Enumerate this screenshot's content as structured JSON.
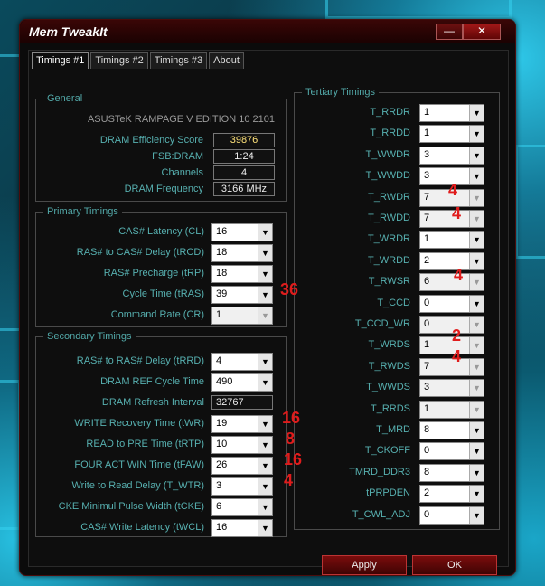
{
  "window": {
    "title": "Mem TweakIt",
    "minimize_label": "—",
    "close_label": "✕"
  },
  "tabs": [
    "Timings #1",
    "Timings #2",
    "Timings #3",
    "About"
  ],
  "general": {
    "title": "General",
    "board": "ASUSTeK RAMPAGE V EDITION 10 2101",
    "efficiency_label": "DRAM Efficiency Score",
    "efficiency_value": "39876",
    "fsb_label": "FSB:DRAM",
    "fsb_value": "1:24",
    "channels_label": "Channels",
    "channels_value": "4",
    "freq_label": "DRAM Frequency",
    "freq_value": "3166 MHz"
  },
  "primary": {
    "title": "Primary Timings",
    "rows": [
      {
        "label": "CAS# Latency (CL)",
        "value": "16",
        "disabled": false
      },
      {
        "label": "RAS# to CAS# Delay (tRCD)",
        "value": "18",
        "disabled": false
      },
      {
        "label": "RAS# Precharge (tRP)",
        "value": "18",
        "disabled": false
      },
      {
        "label": "Cycle Time (tRAS)",
        "value": "39",
        "disabled": false
      },
      {
        "label": "Command Rate (CR)",
        "value": "1",
        "disabled": true
      }
    ]
  },
  "secondary": {
    "title": "Secondary Timings",
    "rows": [
      {
        "label": "RAS# to RAS# Delay (tRRD)",
        "value": "4",
        "type": "dd"
      },
      {
        "label": "DRAM REF Cycle Time",
        "value": "490",
        "type": "dd"
      },
      {
        "label": "DRAM Refresh Interval",
        "value": "32767",
        "type": "box"
      },
      {
        "label": "WRITE Recovery Time (tWR)",
        "value": "19",
        "type": "dd"
      },
      {
        "label": "READ to PRE Time (tRTP)",
        "value": "10",
        "type": "dd"
      },
      {
        "label": "FOUR ACT WIN Time (tFAW)",
        "value": "26",
        "type": "dd"
      },
      {
        "label": "Write to Read Delay (T_WTR)",
        "value": "3",
        "type": "dd"
      },
      {
        "label": "CKE Minimul Pulse Width (tCKE)",
        "value": "6",
        "type": "dd"
      },
      {
        "label": "CAS# Write Latency (tWCL)",
        "value": "16",
        "type": "dd"
      }
    ]
  },
  "tertiary": {
    "title": "Tertiary Timings",
    "rows": [
      {
        "label": "T_RRDR",
        "value": "1",
        "disabled": false
      },
      {
        "label": "T_RRDD",
        "value": "1",
        "disabled": false
      },
      {
        "label": "T_WWDR",
        "value": "3",
        "disabled": false
      },
      {
        "label": "T_WWDD",
        "value": "3",
        "disabled": false
      },
      {
        "label": "T_RWDR",
        "value": "7",
        "disabled": true
      },
      {
        "label": "T_RWDD",
        "value": "7",
        "disabled": true
      },
      {
        "label": "T_WRDR",
        "value": "1",
        "disabled": false
      },
      {
        "label": "T_WRDD",
        "value": "2",
        "disabled": false
      },
      {
        "label": "T_RWSR",
        "value": "6",
        "disabled": true
      },
      {
        "label": "T_CCD",
        "value": "0",
        "disabled": false
      },
      {
        "label": "T_CCD_WR",
        "value": "0",
        "disabled": true
      },
      {
        "label": "T_WRDS",
        "value": "1",
        "disabled": true
      },
      {
        "label": "T_RWDS",
        "value": "7",
        "disabled": true
      },
      {
        "label": "T_WWDS",
        "value": "3",
        "disabled": true
      },
      {
        "label": "T_RRDS",
        "value": "1",
        "disabled": true
      },
      {
        "label": "T_MRD",
        "value": "8",
        "disabled": false
      },
      {
        "label": "T_CKOFF",
        "value": "0",
        "disabled": false
      },
      {
        "label": "TMRD_DDR3",
        "value": "8",
        "disabled": false
      },
      {
        "label": "tPRPDEN",
        "value": "2",
        "disabled": false
      },
      {
        "label": "T_CWL_ADJ",
        "value": "0",
        "disabled": false
      }
    ]
  },
  "annotations": {
    "tras": "36",
    "twr": "16",
    "trtp": "8",
    "tfaw": "16",
    "twtr": "4",
    "rwdr": "4",
    "rwdd": "4",
    "rwsr": "4",
    "wrds": "2",
    "rwds": "4"
  },
  "buttons": {
    "apply": "Apply",
    "ok": "OK"
  }
}
